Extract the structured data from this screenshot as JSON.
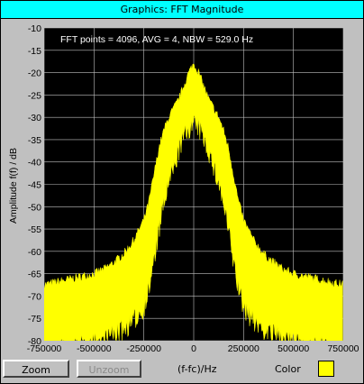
{
  "window": {
    "title": "Graphics: FFT Magnitude"
  },
  "colors": {
    "trace": "#ffff00",
    "plot_bg": "#000000",
    "grid": "#c0c0c0",
    "titlebar": "#00ffff"
  },
  "toolbar": {
    "zoom_label": "Zoom",
    "unzoom_label": "Unzoom",
    "xaxis_label": "(f-fc)/Hz",
    "color_label": "Color",
    "color_value": "#ffff00"
  },
  "chart_data": {
    "type": "line",
    "annotation": "FFT points = 4096, AVG = 4, NBW = 529.0 Hz",
    "xlabel": "(f-fc)/Hz",
    "ylabel": "Amplitude f(f) / dB",
    "xlim": [
      -750000,
      750000
    ],
    "ylim": [
      -80,
      -10
    ],
    "xticks": [
      "-750000",
      "-500000",
      "-250000",
      "0",
      "250000",
      "500000",
      "750000"
    ],
    "yticks": [
      "-10",
      "-15",
      "-20",
      "-25",
      "-30",
      "-35",
      "-40",
      "-45",
      "-50",
      "-55",
      "-60",
      "-65",
      "-70",
      "-75",
      "-80"
    ],
    "grid": true,
    "series": [
      {
        "x": [
          -750000,
          -700000,
          -650000,
          -600000,
          -550000,
          -500000,
          -450000,
          -400000,
          -350000,
          -300000,
          -250000,
          -225000,
          -200000,
          -175000,
          -150000,
          -125000,
          -100000,
          -75000,
          -50000,
          -25000,
          0,
          25000,
          50000,
          75000,
          100000,
          125000,
          150000,
          175000,
          200000,
          225000,
          250000,
          300000,
          350000,
          400000,
          450000,
          500000,
          550000,
          600000,
          650000,
          700000,
          750000
        ],
        "upper": [
          -67.5,
          -67,
          -66.5,
          -66,
          -65.5,
          -65,
          -64,
          -62.5,
          -60.5,
          -57.5,
          -53,
          -49,
          -43,
          -37,
          -33,
          -30,
          -28,
          -26,
          -23,
          -20,
          -18,
          -20,
          -23,
          -26,
          -28,
          -30,
          -33,
          -37,
          -43,
          -49,
          -53,
          -57.5,
          -60.5,
          -62.5,
          -64,
          -65,
          -65.5,
          -66,
          -66.5,
          -67,
          -67.5
        ],
        "lower": [
          -80,
          -80,
          -79,
          -79,
          -78.5,
          -78,
          -77,
          -76,
          -75,
          -73,
          -70,
          -66,
          -60,
          -53,
          -47,
          -42,
          -39,
          -35,
          -32,
          -30,
          -29,
          -30,
          -32,
          -35,
          -39,
          -42,
          -47,
          -53,
          -60,
          -66,
          -70,
          -73,
          -75,
          -76,
          -77,
          -78,
          -78.5,
          -79,
          -79,
          -80,
          -80
        ]
      }
    ]
  }
}
